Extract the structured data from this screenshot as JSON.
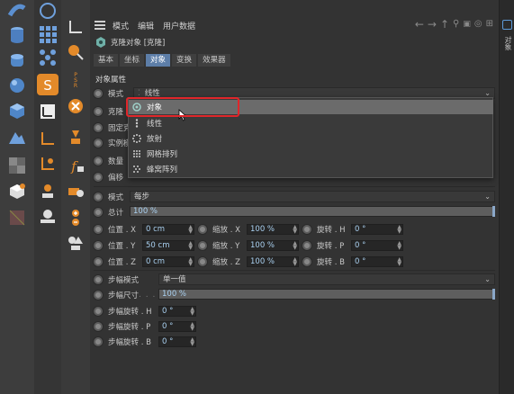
{
  "menu": {
    "modes": "模式",
    "edit": "编辑",
    "user_data": "用户数据"
  },
  "object": {
    "title": "克隆对象 [克隆]"
  },
  "tabs": [
    "基本",
    "坐标",
    "对象",
    "变换",
    "效果器"
  ],
  "active_tab": "对象",
  "section_title": "对象属性",
  "mode_row": {
    "label": "模式",
    "value": "线性"
  },
  "hidden_rows": [
    "克隆",
    "固定克隆",
    "实例模式",
    "数量",
    "偏移"
  ],
  "popup": {
    "items": [
      {
        "label": "对象",
        "icon": "object-mode-icon",
        "selected": true
      },
      {
        "label": "线性",
        "icon": "linear-mode-icon",
        "selected": false
      },
      {
        "label": "放射",
        "icon": "radial-mode-icon",
        "selected": false
      },
      {
        "label": "网格排列",
        "icon": "grid-mode-icon",
        "selected": false
      },
      {
        "label": "蜂窝阵列",
        "icon": "honeycomb-mode-icon",
        "selected": false
      }
    ]
  },
  "transform": {
    "mode_label": "模式",
    "mode_value": "每步",
    "total_label": "总计",
    "total_value": "100 %",
    "total_fraction": 1.0,
    "rows": [
      {
        "pos_label": "位置 . X",
        "pos_value": "0 cm",
        "scale_label": "缩放 . X",
        "scale_value": "100 %",
        "rot_label": "旋转 . H",
        "rot_value": "0 °"
      },
      {
        "pos_label": "位置 . Y",
        "pos_value": "50 cm",
        "scale_label": "缩放 . Y",
        "scale_value": "100 %",
        "rot_label": "旋转 . P",
        "rot_value": "0 °"
      },
      {
        "pos_label": "位置 . Z",
        "pos_value": "0 cm",
        "scale_label": "缩放 . Z",
        "scale_value": "100 %",
        "rot_label": "旋转 . B",
        "rot_value": "0 °"
      }
    ]
  },
  "step": {
    "mode_label": "步幅模式",
    "mode_value": "单一值",
    "size_label": "步幅尺寸",
    "size_value": "100 %",
    "size_fraction": 1.0,
    "rot_h_label": "步幅旋转 . H",
    "rot_h_value": "0 °",
    "rot_p_label": "步幅旋转 . P",
    "rot_p_value": "0 °",
    "rot_b_label": "步幅旋转 . B",
    "rot_b_value": "0 °"
  },
  "right_panel": {
    "tab_label": "对象"
  },
  "colors": {
    "accent": "#5d7ea8",
    "highlight": "#e0262a"
  }
}
